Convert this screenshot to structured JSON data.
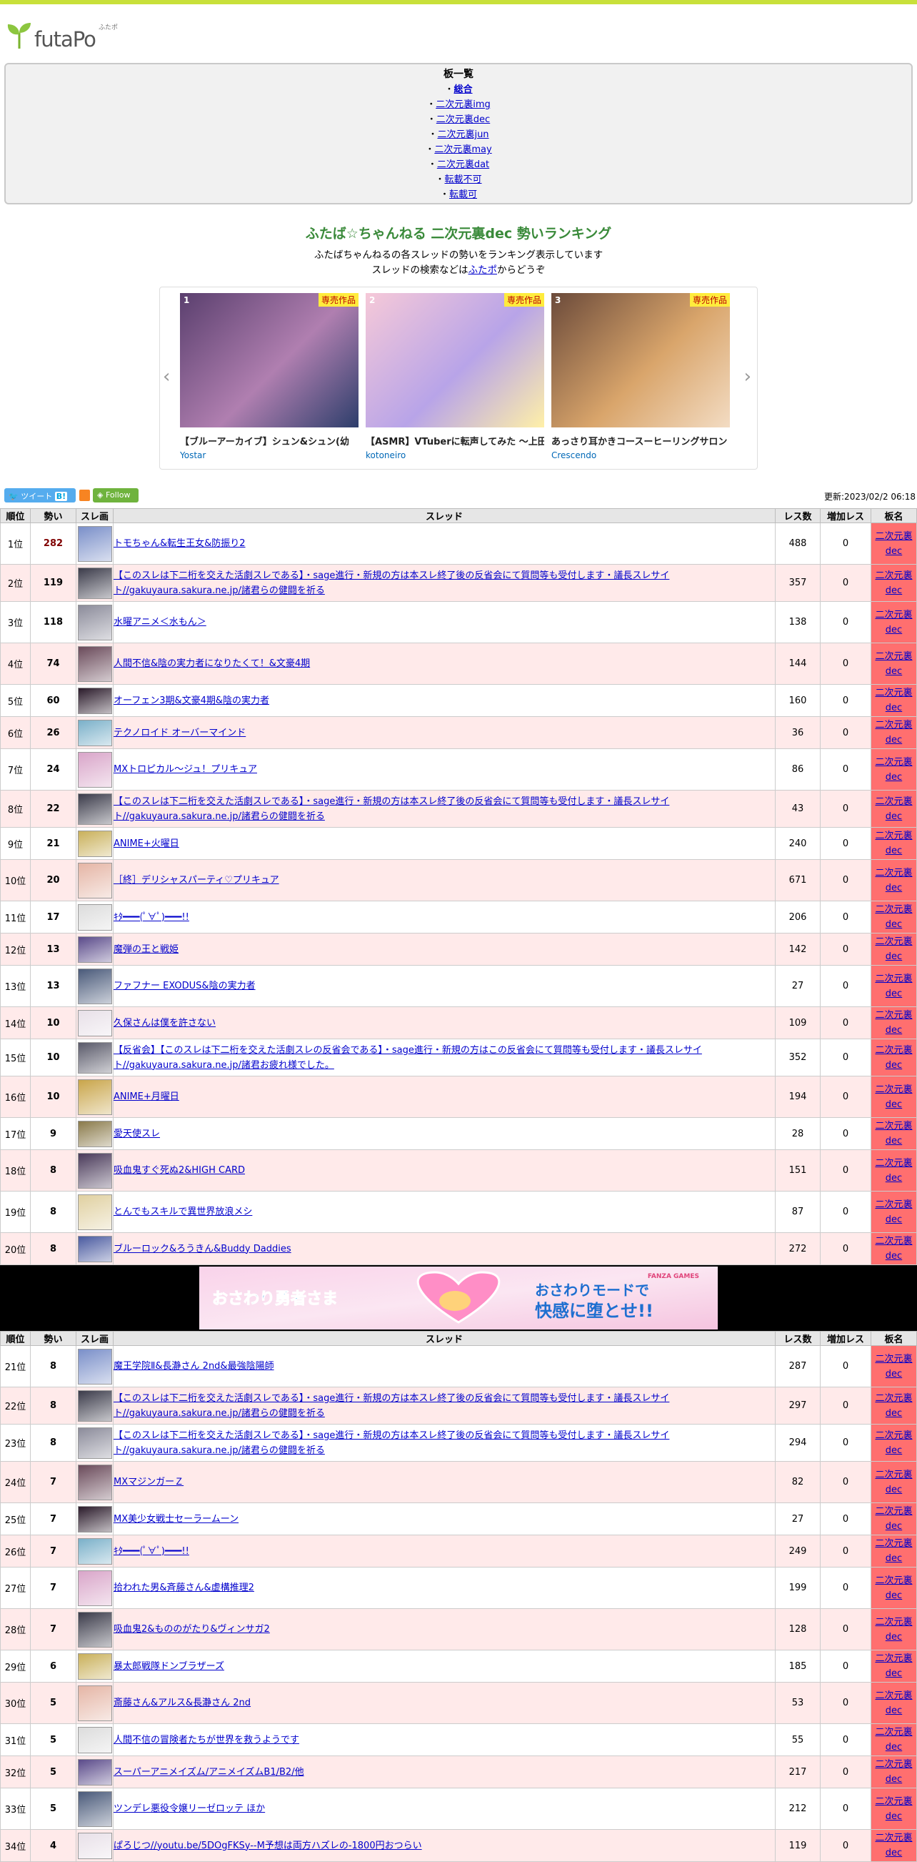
{
  "site": {
    "logo_text": "futaPo",
    "logo_ruby": "ふたポ",
    "page_title": "ふたば☆ちゃんねる 二次元裏dec 勢いランキング",
    "subtitle_1": "ふたばちゃんねるの各スレッドの勢いをランキング表示しています",
    "subtitle_2a": "スレッドの検索などは",
    "subtitle_2_link": "ふたポ",
    "subtitle_2b": "からどうぞ"
  },
  "boards": {
    "title": "板一覧",
    "items": [
      "総合",
      "二次元裏img",
      "二次元裏dec",
      "二次元裏jun",
      "二次元裏may",
      "二次元裏dat",
      "転載不可",
      "転載可",
      "…"
    ]
  },
  "carousel": {
    "items": [
      {
        "rank": "1",
        "tag": "専売作品",
        "title": "【ブルーアーカイブ】シュン&シュン(幼",
        "circle": "Yostar"
      },
      {
        "rank": "2",
        "tag": "専売作品",
        "title": "【ASMR】VTuberに転声してみた 〜上田",
        "circle": "kotoneiro"
      },
      {
        "rank": "3",
        "tag": "専売作品",
        "title": "あっさり耳かきコースーヒーリングサロン",
        "circle": "Crescendo"
      }
    ]
  },
  "social": {
    "tweet": "ツイート",
    "follow": "Follow",
    "updated": "更新:2023/02/2 06:18"
  },
  "table_headers": {
    "rank": "順位",
    "momentum": "勢い",
    "thumb": "スレ画",
    "thread": "スレッド",
    "res": "レス数",
    "inc": "増加レス",
    "board": "板名"
  },
  "board_name_1": "二次元裏",
  "board_name_2": "dec",
  "threads_a": [
    {
      "rank": "1位",
      "momentum": "282",
      "title": "トモちゃん&転生王女&防振り2",
      "res": "488",
      "inc": "0"
    },
    {
      "rank": "2位",
      "momentum": "119",
      "title": "【このスレは下二桁を交えた活劇スレである】・sage進行・新規の方は本スレ終了後の反省会にて質問等も受付します・議長スレサイト//gakuyaura.sakura.ne.jp/諸君らの健闘を祈る",
      "res": "357",
      "inc": "0"
    },
    {
      "rank": "3位",
      "momentum": "118",
      "title": "水曜アニメ＜水もん＞",
      "res": "138",
      "inc": "0"
    },
    {
      "rank": "4位",
      "momentum": "74",
      "title": "人間不信&陰の実力者になりたくて！&文豪4期",
      "res": "144",
      "inc": "0"
    },
    {
      "rank": "5位",
      "momentum": "60",
      "title": "オーフェン3期&文豪4期&陰の実力者",
      "res": "160",
      "inc": "0"
    },
    {
      "rank": "6位",
      "momentum": "26",
      "title": "テクノロイド オーバーマインド",
      "res": "36",
      "inc": "0"
    },
    {
      "rank": "7位",
      "momentum": "24",
      "title": "MXトロピカル～ジュ！プリキュア",
      "res": "86",
      "inc": "0"
    },
    {
      "rank": "8位",
      "momentum": "22",
      "title": "【このスレは下二桁を交えた活劇スレである】・sage進行・新規の方は本スレ終了後の反省会にて質問等も受付します・議長スレサイト//gakuyaura.sakura.ne.jp/諸君らの健闘を祈る",
      "res": "43",
      "inc": "0"
    },
    {
      "rank": "9位",
      "momentum": "21",
      "title": "ANIME+火曜日",
      "res": "240",
      "inc": "0"
    },
    {
      "rank": "10位",
      "momentum": "20",
      "title": "［終］デリシャスパーティ♡プリキュア",
      "res": "671",
      "inc": "0"
    },
    {
      "rank": "11位",
      "momentum": "17",
      "title": "ｷﾀ━━━(ﾟ∀ﾟ)━━━!!",
      "res": "206",
      "inc": "0"
    },
    {
      "rank": "12位",
      "momentum": "13",
      "title": "魔弾の王と戦姫",
      "res": "142",
      "inc": "0"
    },
    {
      "rank": "13位",
      "momentum": "13",
      "title": "ファフナー EXODUS&陰の実力者",
      "res": "27",
      "inc": "0"
    },
    {
      "rank": "14位",
      "momentum": "10",
      "title": "久保さんは僕を許さない",
      "res": "109",
      "inc": "0"
    },
    {
      "rank": "15位",
      "momentum": "10",
      "title": "【反省会】【このスレは下二桁を交えた活劇スレの反省会である】・sage進行・新規の方はこの反省会にて質問等も受付します・議長スレサイト//gakuyaura.sakura.ne.jp/諸君お疲れ様でした。",
      "res": "352",
      "inc": "0"
    },
    {
      "rank": "16位",
      "momentum": "10",
      "title": "ANIME+月曜日",
      "res": "194",
      "inc": "0"
    },
    {
      "rank": "17位",
      "momentum": "9",
      "title": "愛天使スレ",
      "res": "28",
      "inc": "0"
    },
    {
      "rank": "18位",
      "momentum": "8",
      "title": "吸血鬼すぐ死ぬ2&HIGH CARD",
      "res": "151",
      "inc": "0"
    },
    {
      "rank": "19位",
      "momentum": "8",
      "title": "とんでもスキルで異世界放浪メシ",
      "res": "87",
      "inc": "0"
    },
    {
      "rank": "20位",
      "momentum": "8",
      "title": "ブルーロック&ろうきん&Buddy Daddies",
      "res": "272",
      "inc": "0"
    }
  ],
  "banner": {
    "left_text": "おさわり勇者さま",
    "brand": "FANZA GAMES",
    "right_line1": "おさわりモードで",
    "right_line2": "快感に堕とせ!!"
  },
  "threads_b": [
    {
      "rank": "21位",
      "momentum": "8",
      "title": "魔王学院Ⅱ&長瀞さん 2nd&最強陰陽師",
      "res": "287",
      "inc": "0"
    },
    {
      "rank": "22位",
      "momentum": "8",
      "title": "【このスレは下二桁を交えた活劇スレである】・sage進行・新規の方は本スレ終了後の反省会にて質問等も受付します・議長スレサイト//gakuyaura.sakura.ne.jp/諸君らの健闘を祈る",
      "res": "297",
      "inc": "0"
    },
    {
      "rank": "23位",
      "momentum": "8",
      "title": "【このスレは下二桁を交えた活劇スレである】・sage進行・新規の方は本スレ終了後の反省会にて質問等も受付します・議長スレサイト//gakuyaura.sakura.ne.jp/諸君らの健闘を祈る",
      "res": "294",
      "inc": "0"
    },
    {
      "rank": "24位",
      "momentum": "7",
      "title": "MXマジンガーＺ",
      "res": "82",
      "inc": "0"
    },
    {
      "rank": "25位",
      "momentum": "7",
      "title": "MX美少女戦士セーラームーン",
      "res": "27",
      "inc": "0"
    },
    {
      "rank": "26位",
      "momentum": "7",
      "title": "ｷﾀ━━━(ﾟ∀ﾟ)━━━!!",
      "res": "249",
      "inc": "0"
    },
    {
      "rank": "27位",
      "momentum": "7",
      "title": "拾われた男&斉藤さん&虚構推理2",
      "res": "199",
      "inc": "0"
    },
    {
      "rank": "28位",
      "momentum": "7",
      "title": "吸血鬼2&もののがたり&ヴィンサガ2",
      "res": "128",
      "inc": "0"
    },
    {
      "rank": "29位",
      "momentum": "6",
      "title": "暴太郎戦隊ドンブラザーズ",
      "res": "185",
      "inc": "0"
    },
    {
      "rank": "30位",
      "momentum": "5",
      "title": "斎藤さん&アルス&長瀞さん 2nd",
      "res": "53",
      "inc": "0"
    },
    {
      "rank": "31位",
      "momentum": "5",
      "title": "人間不信の冒険者たちが世界を救うようです",
      "res": "55",
      "inc": "0"
    },
    {
      "rank": "32位",
      "momentum": "5",
      "title": "スーパーアニメイズム/アニメイズムB1/B2/他",
      "res": "217",
      "inc": "0"
    },
    {
      "rank": "33位",
      "momentum": "5",
      "title": "ツンデレ悪役令嬢リーゼロッテ ほか",
      "res": "212",
      "inc": "0"
    },
    {
      "rank": "34位",
      "momentum": "4",
      "title": "ぱろじつ//youtu.be/5DOgFKSy--M予想は両方ハズレの-1800円おつらい",
      "res": "119",
      "inc": "0"
    }
  ]
}
